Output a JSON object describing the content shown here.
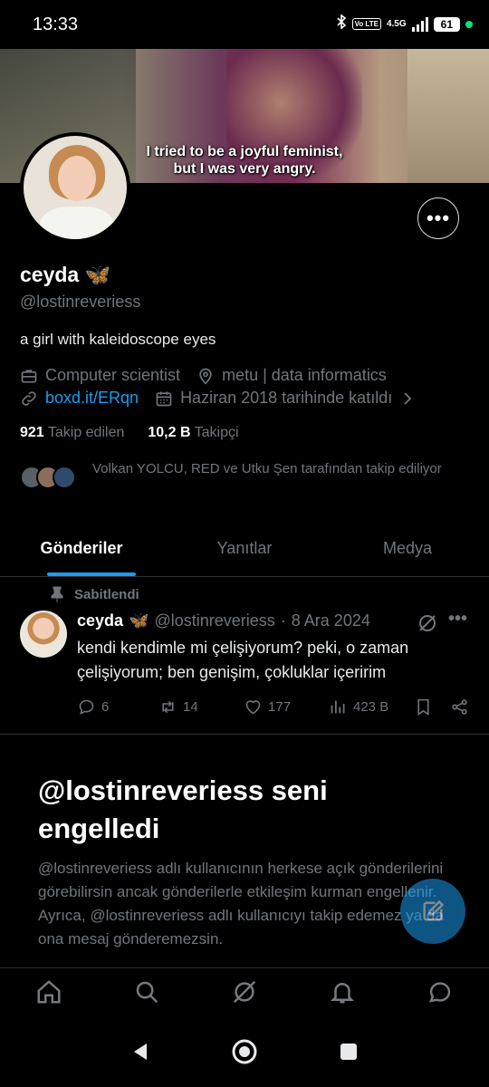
{
  "status_bar": {
    "time": "13:33",
    "volte": "Vo LTE",
    "network": "4.5G",
    "battery": "61"
  },
  "banner": {
    "caption_line1": "I tried to be a joyful feminist,",
    "caption_line2": "but I was very angry."
  },
  "profile": {
    "display_name": "ceyda",
    "name_emoji": "🦋",
    "handle": "@lostinreveriess",
    "bio": "a girl with kaleidoscope eyes",
    "profession": "Computer scientist",
    "location": "metu | data informatics",
    "link": "boxd.it/ERqn",
    "joined": "Haziran 2018 tarihinde katıldı",
    "following_count": "921",
    "following_label": "Takip edilen",
    "followers_count": "10,2 B",
    "followers_label": "Takipçi",
    "followed_by_text": "Volkan YOLCU, RED ve Utku Şen tarafından takip ediliyor"
  },
  "tabs": [
    {
      "label": "Gönderiler",
      "active": true
    },
    {
      "label": "Yanıtlar",
      "active": false
    },
    {
      "label": "Medya",
      "active": false
    }
  ],
  "pinned_post": {
    "pinned_label": "Sabitlendi",
    "author": "ceyda",
    "author_emoji": "🦋",
    "handle": "@lostinreveriess",
    "separator": "·",
    "date": "8 Ara 2024",
    "text": "kendi kendimle mi çelişiyorum? peki, o zaman çelişiyorum; ben genişim, çokluklar içeririm",
    "replies": "6",
    "reposts": "14",
    "likes": "177",
    "views": "423 B"
  },
  "blocked": {
    "title": "@lostinreveriess seni engelledi",
    "text": "@lostinreveriess adlı kullanıcının herkese açık gönderilerini görebilirsin ancak gönderilerle etkileşim kurman engellenir. Ayrıca, @lostinreveriess adlı kullanıcıyı takip edemez ya da ona mesaj gönderemezsin."
  },
  "colors": {
    "accent": "#1d9bf0",
    "muted": "#71767b",
    "border": "#2f3336"
  },
  "icons": {
    "more": "ellipsis-icon",
    "grok": "grok-icon",
    "compose": "compose-icon"
  }
}
